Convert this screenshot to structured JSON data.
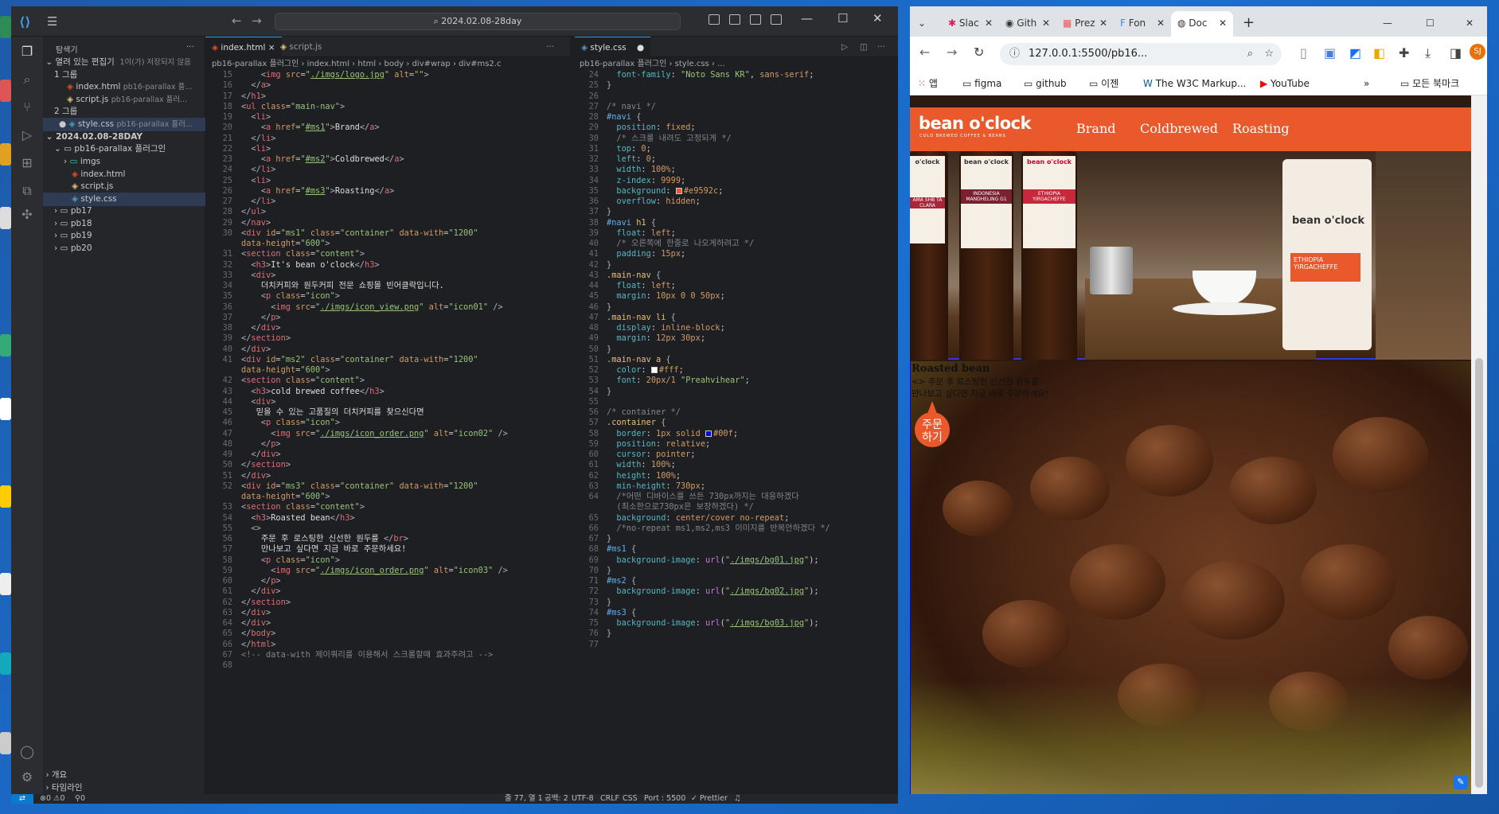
{
  "vscode": {
    "title_search": "2024.02.08-28day",
    "sidebar": {
      "header": "탐색기",
      "open_editors": "열려 있는 편집기",
      "unsaved": "1이(가) 저장되지 않음",
      "group1": "1 그룹",
      "group2": "2 그룹",
      "g1_files": [
        {
          "name": "index.html",
          "path": "pb16-parallax 플..."
        },
        {
          "name": "script.js",
          "path": "pb16-parallax 플러..."
        }
      ],
      "g2_files": [
        {
          "name": "style.css",
          "path": "pb16-parallax 플러..."
        }
      ],
      "project": "2024.02.08-28DAY",
      "folder": "pb16-parallax 플러그인",
      "tree": [
        "imgs",
        "index.html",
        "script.js",
        "style.css"
      ],
      "other_folders": [
        "pb17",
        "pb18",
        "pb19",
        "pb20"
      ],
      "outline": "개요",
      "timeline": "타임라인"
    },
    "tabs_left": [
      {
        "name": "index.html",
        "close": "×"
      },
      {
        "name": "script.js"
      }
    ],
    "tabs_right": [
      {
        "name": "style.css",
        "dot": "●"
      }
    ],
    "breadcrumb_left": "pb16-parallax 플러그인 › index.html › html › body › div#wrap › div#ms2.c",
    "breadcrumb_right": "pb16-parallax 플러그인 › style.css › ...",
    "status": {
      "errors": "⊗0 ⚠0",
      "ports": "⚲0",
      "position": "줄 77, 열 1",
      "spaces": "공백: 2",
      "encoding": "UTF-8",
      "eol": "CRLF",
      "lang": "CSS",
      "port": "Port : 5500",
      "prettier": "✓ Prettier"
    }
  },
  "chrome": {
    "tabs": [
      "Slac",
      "Gith",
      "Prez",
      "Fon",
      "Doc"
    ],
    "url": "127.0.0.1:5500/pb16...",
    "bookmarks": [
      "앱",
      "figma",
      "github",
      "이젠",
      "The W3C Markup...",
      "YouTube"
    ],
    "all_bookmarks": "모든 북마크",
    "profile": "SJ",
    "page": {
      "logo": "bean o'clock",
      "logo_sub": "COLD BREWED COFFEE & BEANS",
      "nav": [
        "Brand",
        "Coldbrewed",
        "Roasting"
      ],
      "bottle_labels": [
        "o'clock",
        "bean o'clock",
        "bean o'clock"
      ],
      "bottle_names": [
        "AMA SHB TA CLARA",
        "INDONESIA MANDHELING G1",
        "ETHIOPIA YIRGACHEFFE"
      ],
      "bag_brand": "bean o'clock",
      "bag_label": "ETHIOPIA YIRGACHEFFE",
      "section_title": "Roasted bean",
      "line1": "<> 주문 후 로스팅한 신선한 원두를",
      "line2": "만나보고 싶다면 지금 바로 주문하세요!",
      "order_icon_text": "주문\n하기"
    }
  },
  "colors": {
    "nav_bg": "#e9592c",
    "border": "#00f",
    "accent": "#0a7acc"
  }
}
